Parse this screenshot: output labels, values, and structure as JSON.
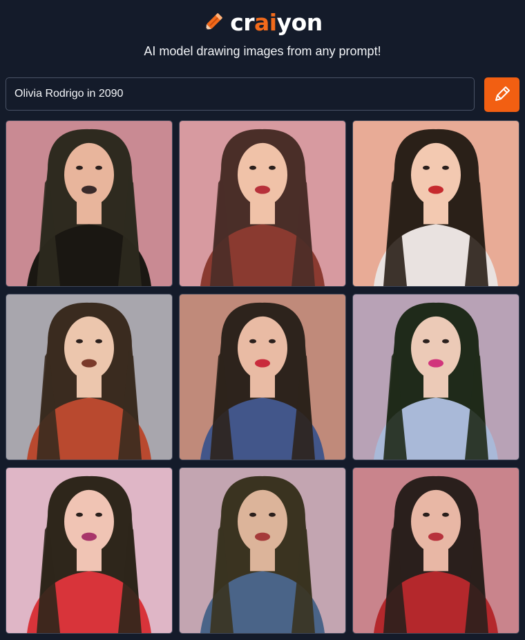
{
  "brand": {
    "name_prefix": "cr",
    "name_ai": "ai",
    "name_suffix": "yon",
    "accent": "#f26a1b"
  },
  "tagline": "AI model drawing images from any prompt!",
  "prompt": {
    "value": "Olivia Rodrigo in 2090",
    "button_icon": "pencil-icon"
  },
  "results": [
    {
      "bg": "#c98a93",
      "hair": "#2e2a1f",
      "skin": "#e8b59c",
      "top": "#1a1712",
      "lips": "#3a2a2a"
    },
    {
      "bg": "#d79aa0",
      "hair": "#4a2e28",
      "skin": "#f0c2a8",
      "top": "#8a3a30",
      "lips": "#b7303a"
    },
    {
      "bg": "#e8ab96",
      "hair": "#2a2018",
      "skin": "#f3c9b1",
      "top": "#e9e2e0",
      "lips": "#c62a2e"
    },
    {
      "bg": "#a8a6ad",
      "hair": "#3a2b1f",
      "skin": "#ecc6ad",
      "top": "#b9492f",
      "lips": "#7a3a2a"
    },
    {
      "bg": "#c08a7a",
      "hair": "#2d231c",
      "skin": "#e9bba4",
      "top": "#42568a",
      "lips": "#c92b3c"
    },
    {
      "bg": "#b8a2b6",
      "hair": "#1f2a1a",
      "skin": "#eccab7",
      "top": "#a9b9d8",
      "lips": "#d1357c"
    },
    {
      "bg": "#dfb6c6",
      "hair": "#2e261b",
      "skin": "#f0c4b4",
      "top": "#d8343a",
      "lips": "#a8356a"
    },
    {
      "bg": "#c3a5b1",
      "hair": "#3a3320",
      "skin": "#dcb49a",
      "top": "#4a6488",
      "lips": "#a53a3a"
    },
    {
      "bg": "#c9848c",
      "hair": "#2a1f1c",
      "skin": "#e8b7a5",
      "top": "#b4282c",
      "lips": "#b7323c"
    }
  ]
}
